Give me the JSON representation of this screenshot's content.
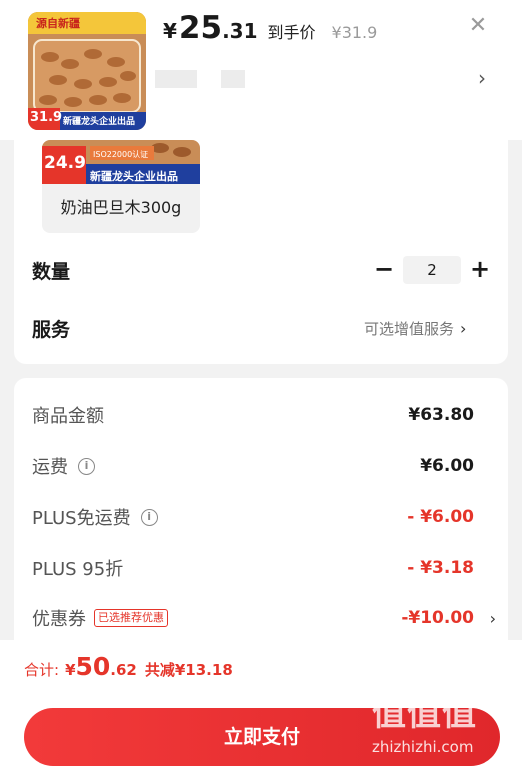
{
  "product": {
    "price_currency": "¥",
    "price_integer": "25",
    "price_decimal": ".31",
    "price_tag": "到手价",
    "original_price": "¥31.9",
    "thumb_badge": "源自新疆",
    "thumb_price": "31.9",
    "thumb_banner": "新疆龙头企业出品",
    "close_icon": "close-icon"
  },
  "variant": {
    "img_price": "24.9",
    "img_cert": "ISO22000认证",
    "img_banner": "新疆龙头企业出品",
    "label": "奶油巴旦木300g"
  },
  "quantity": {
    "label": "数量",
    "value": "2",
    "minus": "−",
    "plus": "+"
  },
  "service": {
    "label": "服务",
    "hint": "可选增值服务",
    "chevron": "›"
  },
  "fees": {
    "goods_label": "商品金额",
    "goods_value": "¥63.80",
    "shipping_label": "运费",
    "shipping_value": "¥6.00",
    "plus_free_label": "PLUS免运费",
    "plus_free_value": "- ¥6.00",
    "plus95_label": "PLUS 95折",
    "plus95_value": "- ¥3.18",
    "coupon_label": "优惠券",
    "coupon_badge": "已选推荐优惠",
    "coupon_value": "-¥10.00"
  },
  "footer": {
    "total_label": "合计:",
    "total_currency": "¥",
    "total_integer": "50",
    "total_decimal": ".62",
    "total_saved": "共减¥13.18",
    "pay_button": "立即支付",
    "watermark_text": "zhizhizhi.com",
    "watermark_logo": "值值值"
  },
  "colors": {
    "accent": "#e5352a",
    "button": "#ef3434"
  }
}
